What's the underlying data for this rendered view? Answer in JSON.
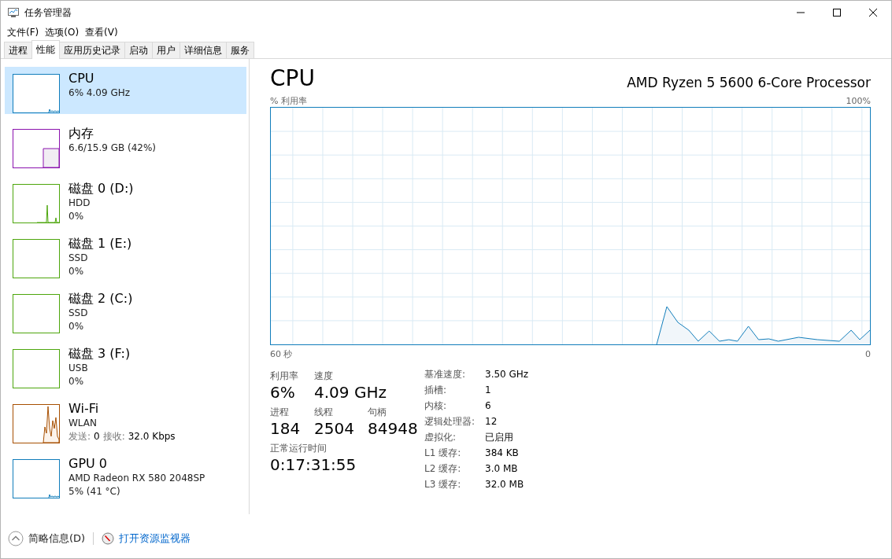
{
  "window": {
    "title": "任务管理器"
  },
  "menu": [
    "文件(F)",
    "选项(O)",
    "查看(V)"
  ],
  "tabs": [
    {
      "label": "进程",
      "selected": false
    },
    {
      "label": "性能",
      "selected": true
    },
    {
      "label": "应用历史记录",
      "selected": false
    },
    {
      "label": "启动",
      "selected": false
    },
    {
      "label": "用户",
      "selected": false
    },
    {
      "label": "详细信息",
      "selected": false
    },
    {
      "label": "服务",
      "selected": false
    }
  ],
  "sidebar": {
    "items": [
      {
        "kind": "cpu",
        "title": "CPU",
        "lines": [
          "6% 4.09 GHz"
        ],
        "color": "#117dbb",
        "selected": true
      },
      {
        "kind": "memory",
        "title": "内存",
        "lines": [
          "6.6/15.9 GB (42%)"
        ],
        "color": "#8b12ae",
        "selected": false
      },
      {
        "kind": "disk_active",
        "title": "磁盘 0 (D:)",
        "lines": [
          "HDD",
          "0%"
        ],
        "color": "#4da60c",
        "selected": false
      },
      {
        "kind": "disk",
        "title": "磁盘 1 (E:)",
        "lines": [
          "SSD",
          "0%"
        ],
        "color": "#4da60c",
        "selected": false
      },
      {
        "kind": "disk",
        "title": "磁盘 2 (C:)",
        "lines": [
          "SSD",
          "0%"
        ],
        "color": "#4da60c",
        "selected": false
      },
      {
        "kind": "disk",
        "title": "磁盘 3 (F:)",
        "lines": [
          "USB",
          "0%"
        ],
        "color": "#4da60c",
        "selected": false
      },
      {
        "kind": "network",
        "title": "Wi-Fi",
        "lines": [
          "WLAN"
        ],
        "throughput": [
          {
            "label": "发送:",
            "value": "0"
          },
          {
            "label": "接收:",
            "value": "32.0 Kbps"
          }
        ],
        "color": "#a74f01",
        "selected": false
      },
      {
        "kind": "gpu",
        "title": "GPU 0",
        "lines": [
          "AMD Radeon RX 580 2048SP",
          "5% (41 °C)"
        ],
        "color": "#117dbb",
        "selected": false
      }
    ]
  },
  "main": {
    "title": "CPU",
    "processor": "AMD Ryzen 5 5600 6-Core Processor",
    "graph": {
      "y_label": "% 利用率",
      "y_max": "100%",
      "x_start": "60 秒",
      "x_end": "0"
    },
    "stat_rows": [
      [
        {
          "label": "利用率",
          "value": "6%"
        },
        {
          "label": "速度",
          "value": "4.09 GHz"
        }
      ],
      [
        {
          "label": "进程",
          "value": "184"
        },
        {
          "label": "线程",
          "value": "2504"
        },
        {
          "label": "句柄",
          "value": "84948"
        }
      ],
      [
        {
          "label": "正常运行时间",
          "value": "0:17:31:55"
        }
      ]
    ],
    "details": [
      {
        "label": "基准速度:",
        "value": "3.50 GHz"
      },
      {
        "label": "插槽:",
        "value": "1"
      },
      {
        "label": "内核:",
        "value": "6"
      },
      {
        "label": "逻辑处理器:",
        "value": "12"
      },
      {
        "label": "虚拟化:",
        "value": "已启用"
      },
      {
        "label": "L1 缓存:",
        "value": "384 KB"
      },
      {
        "label": "L2 缓存:",
        "value": "3.0 MB"
      },
      {
        "label": "L3 缓存:",
        "value": "32.0 MB"
      }
    ]
  },
  "footer": {
    "summary": "简略信息(D)",
    "monitor_link": "打开资源监视器"
  }
}
